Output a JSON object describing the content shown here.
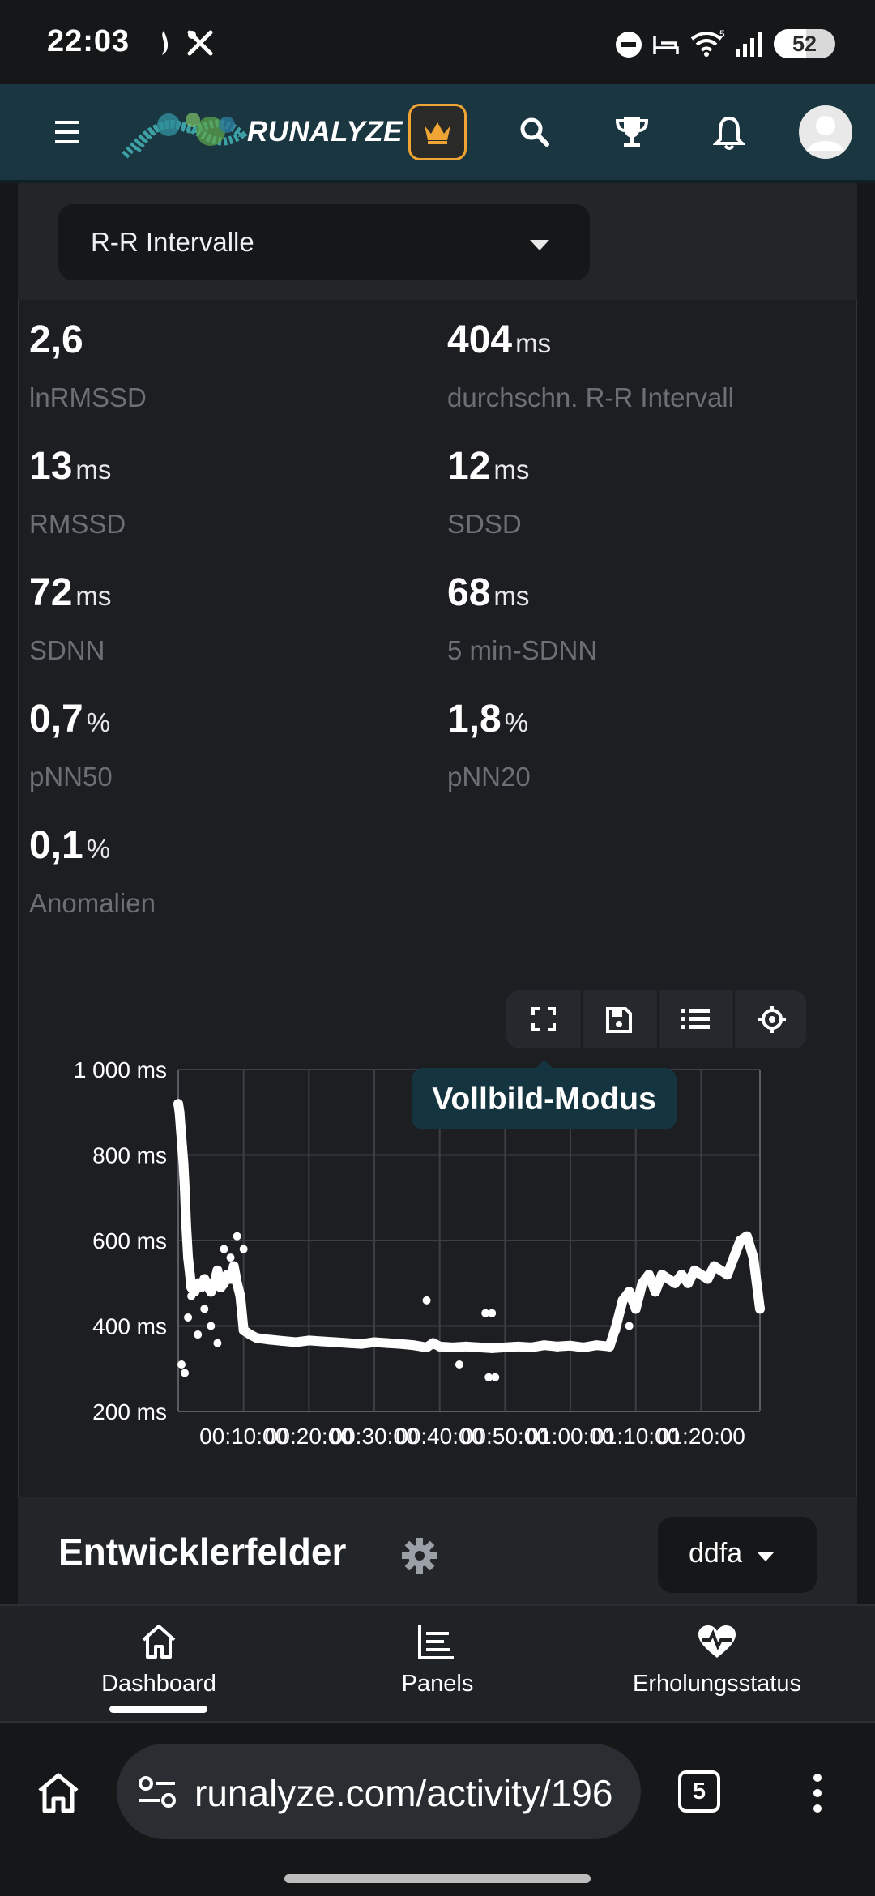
{
  "status_bar": {
    "time": "22:03",
    "icons": [
      "flame-icon",
      "tools-icon",
      "do-not-disturb-icon",
      "sleep-icon",
      "wifi-icon",
      "signal-icon"
    ],
    "battery": "52",
    "battery_level_percent": 52
  },
  "header": {
    "brand": "RUNALYZE",
    "icons": [
      "menu-icon",
      "premium-crown-icon",
      "search-icon",
      "trophy-icon",
      "bell-icon",
      "avatar"
    ],
    "accent": "#f0a433",
    "background": "#1a3640"
  },
  "selector": {
    "value": "R-R Intervalle"
  },
  "metrics": [
    {
      "value": "2,6",
      "unit": "",
      "label": "lnRMSSD"
    },
    {
      "value": "404",
      "unit": "ms",
      "label": "durchschn. R-R Intervall"
    },
    {
      "value": "13",
      "unit": "ms",
      "label": "RMSSD"
    },
    {
      "value": "12",
      "unit": "ms",
      "label": "SDSD"
    },
    {
      "value": "72",
      "unit": "ms",
      "label": "SDNN"
    },
    {
      "value": "68",
      "unit": "ms",
      "label": "5 min-SDNN"
    },
    {
      "value": "0,7",
      "unit": "%",
      "label": "pNN50"
    },
    {
      "value": "1,8",
      "unit": "%",
      "label": "pNN20"
    },
    {
      "value": "0,1",
      "unit": "%",
      "label": "Anomalien"
    }
  ],
  "chart_toolbar": {
    "icons": [
      "fullscreen-icon",
      "save-icon",
      "list-icon",
      "crosshair-icon"
    ],
    "tooltip": "Vollbild-Modus"
  },
  "chart_data": {
    "type": "scatter",
    "title": "",
    "xlabel": "",
    "ylabel": "",
    "y_ticks": [
      "1 000 ms",
      "800 ms",
      "600 ms",
      "400 ms",
      "200 ms"
    ],
    "x_ticks": [
      "00:10:00",
      "00:20:00",
      "00:30:00",
      "00:40:00",
      "00:50:00",
      "01:00:00",
      "01:10:00",
      "01:20:00"
    ],
    "ylim": [
      200,
      1000
    ],
    "xlim_minutes": [
      0,
      89
    ],
    "grid": true,
    "series": [
      {
        "color": "#ffffff",
        "x": [
          0,
          0.2,
          0.4,
          0.6,
          0.8,
          1,
          1.2,
          1.5,
          1.8,
          2,
          2.5,
          3,
          3.5,
          4,
          4.5,
          5,
          5.5,
          6,
          6.5,
          7,
          7.5,
          8,
          8.5,
          9,
          9.5,
          10,
          10.5,
          11,
          12,
          14,
          16,
          18,
          20,
          22,
          24,
          26,
          28,
          30,
          32,
          34,
          36,
          38,
          39,
          40,
          42,
          44,
          46,
          48,
          50,
          52,
          54,
          56,
          58,
          60,
          62,
          64,
          66,
          67,
          68,
          69,
          70,
          71,
          72,
          73,
          74,
          75,
          76,
          77,
          78,
          79,
          80,
          81,
          82,
          83,
          84,
          85,
          86,
          87,
          88,
          89
        ],
        "y": [
          920,
          900,
          860,
          820,
          780,
          720,
          640,
          560,
          520,
          490,
          480,
          500,
          490,
          510,
          495,
          480,
          500,
          530,
          490,
          500,
          520,
          510,
          540,
          500,
          470,
          390,
          385,
          380,
          372,
          368,
          365,
          362,
          366,
          364,
          362,
          360,
          358,
          362,
          360,
          358,
          355,
          350,
          360,
          352,
          350,
          352,
          350,
          348,
          350,
          352,
          350,
          355,
          352,
          354,
          350,
          355,
          352,
          400,
          460,
          480,
          440,
          500,
          520,
          480,
          520,
          510,
          500,
          520,
          500,
          530,
          520,
          510,
          540,
          530,
          520,
          560,
          600,
          610,
          560,
          440
        ]
      },
      {
        "name": "",
        "color": "#ffffff",
        "x": [
          0.5,
          1,
          1.5,
          2,
          3,
          4,
          5,
          6,
          7,
          8,
          9,
          10,
          38,
          43,
          47,
          48,
          47.5,
          48.5,
          67,
          69
        ],
        "y": [
          310,
          290,
          420,
          470,
          380,
          440,
          400,
          360,
          580,
          560,
          610,
          580,
          460,
          310,
          430,
          430,
          280,
          280,
          390,
          400
        ]
      }
    ]
  },
  "developer_fields": {
    "title": "Entwicklerfelder",
    "dropdown": "ddfa"
  },
  "bottom_nav": [
    {
      "label": "Dashboard",
      "icon": "home-icon",
      "active": true
    },
    {
      "label": "Panels",
      "icon": "panels-chart-icon",
      "active": false
    },
    {
      "label": "Erholungsstatus",
      "icon": "heart-pulse-icon",
      "active": false
    }
  ],
  "browser": {
    "url": "runalyze.com/activity/196",
    "tab_count": "5"
  }
}
